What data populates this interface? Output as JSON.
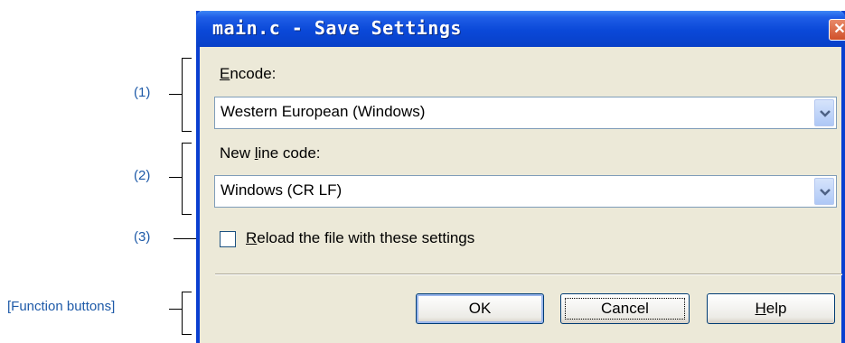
{
  "window": {
    "title": "main.c - Save Settings",
    "close_glyph": "✕"
  },
  "encode": {
    "label": "Encode:",
    "mnemonic": "E",
    "rest": "ncode:",
    "value": "Western European (Windows)"
  },
  "newline": {
    "label": "New line code:",
    "pre": "New ",
    "mnemonic": "l",
    "rest": "ine code:",
    "value": "Windows (CR LF)"
  },
  "reload": {
    "label": "Reload the file with these settings",
    "mnemonic": "R",
    "rest": "eload the file with these settings",
    "checked": false
  },
  "buttons": {
    "ok": "OK",
    "cancel": "Cancel",
    "help": "Help",
    "help_mnemonic": "H",
    "help_rest": "elp"
  },
  "annotations": {
    "a1": "(1)",
    "a2": "(2)",
    "a3": "(3)",
    "function_buttons": "[Function buttons]"
  },
  "colors": {
    "title_bar": "#0a48d8",
    "annotation_text": "#1e5aa8",
    "dialog_bg": "#ece9d8"
  }
}
